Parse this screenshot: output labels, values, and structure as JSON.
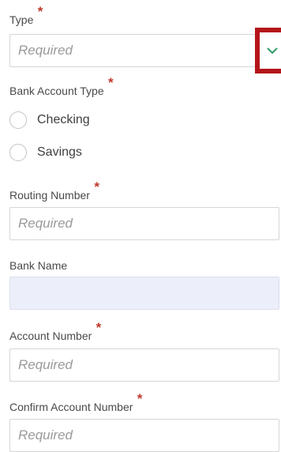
{
  "form": {
    "type": {
      "label": "Type",
      "required_mark": "*",
      "placeholder": "Required"
    },
    "bank_account_type": {
      "label": "Bank Account Type",
      "required_mark": "*",
      "options": [
        "Checking",
        "Savings"
      ]
    },
    "routing_number": {
      "label": "Routing Number",
      "required_mark": "*",
      "placeholder": "Required"
    },
    "bank_name": {
      "label": "Bank Name",
      "value": ""
    },
    "account_number": {
      "label": "Account Number",
      "required_mark": "*",
      "placeholder": "Required"
    },
    "confirm_account_number": {
      "label": "Confirm Account Number",
      "required_mark": "*",
      "placeholder": "Required"
    }
  },
  "colors": {
    "required_mark": "#c0392b",
    "dropdown_highlight": "#b4151b",
    "chevron": "#2e9e6a",
    "readonly_bg": "#eceef9"
  },
  "icons": {
    "dropdown": "chevron-down-icon"
  }
}
